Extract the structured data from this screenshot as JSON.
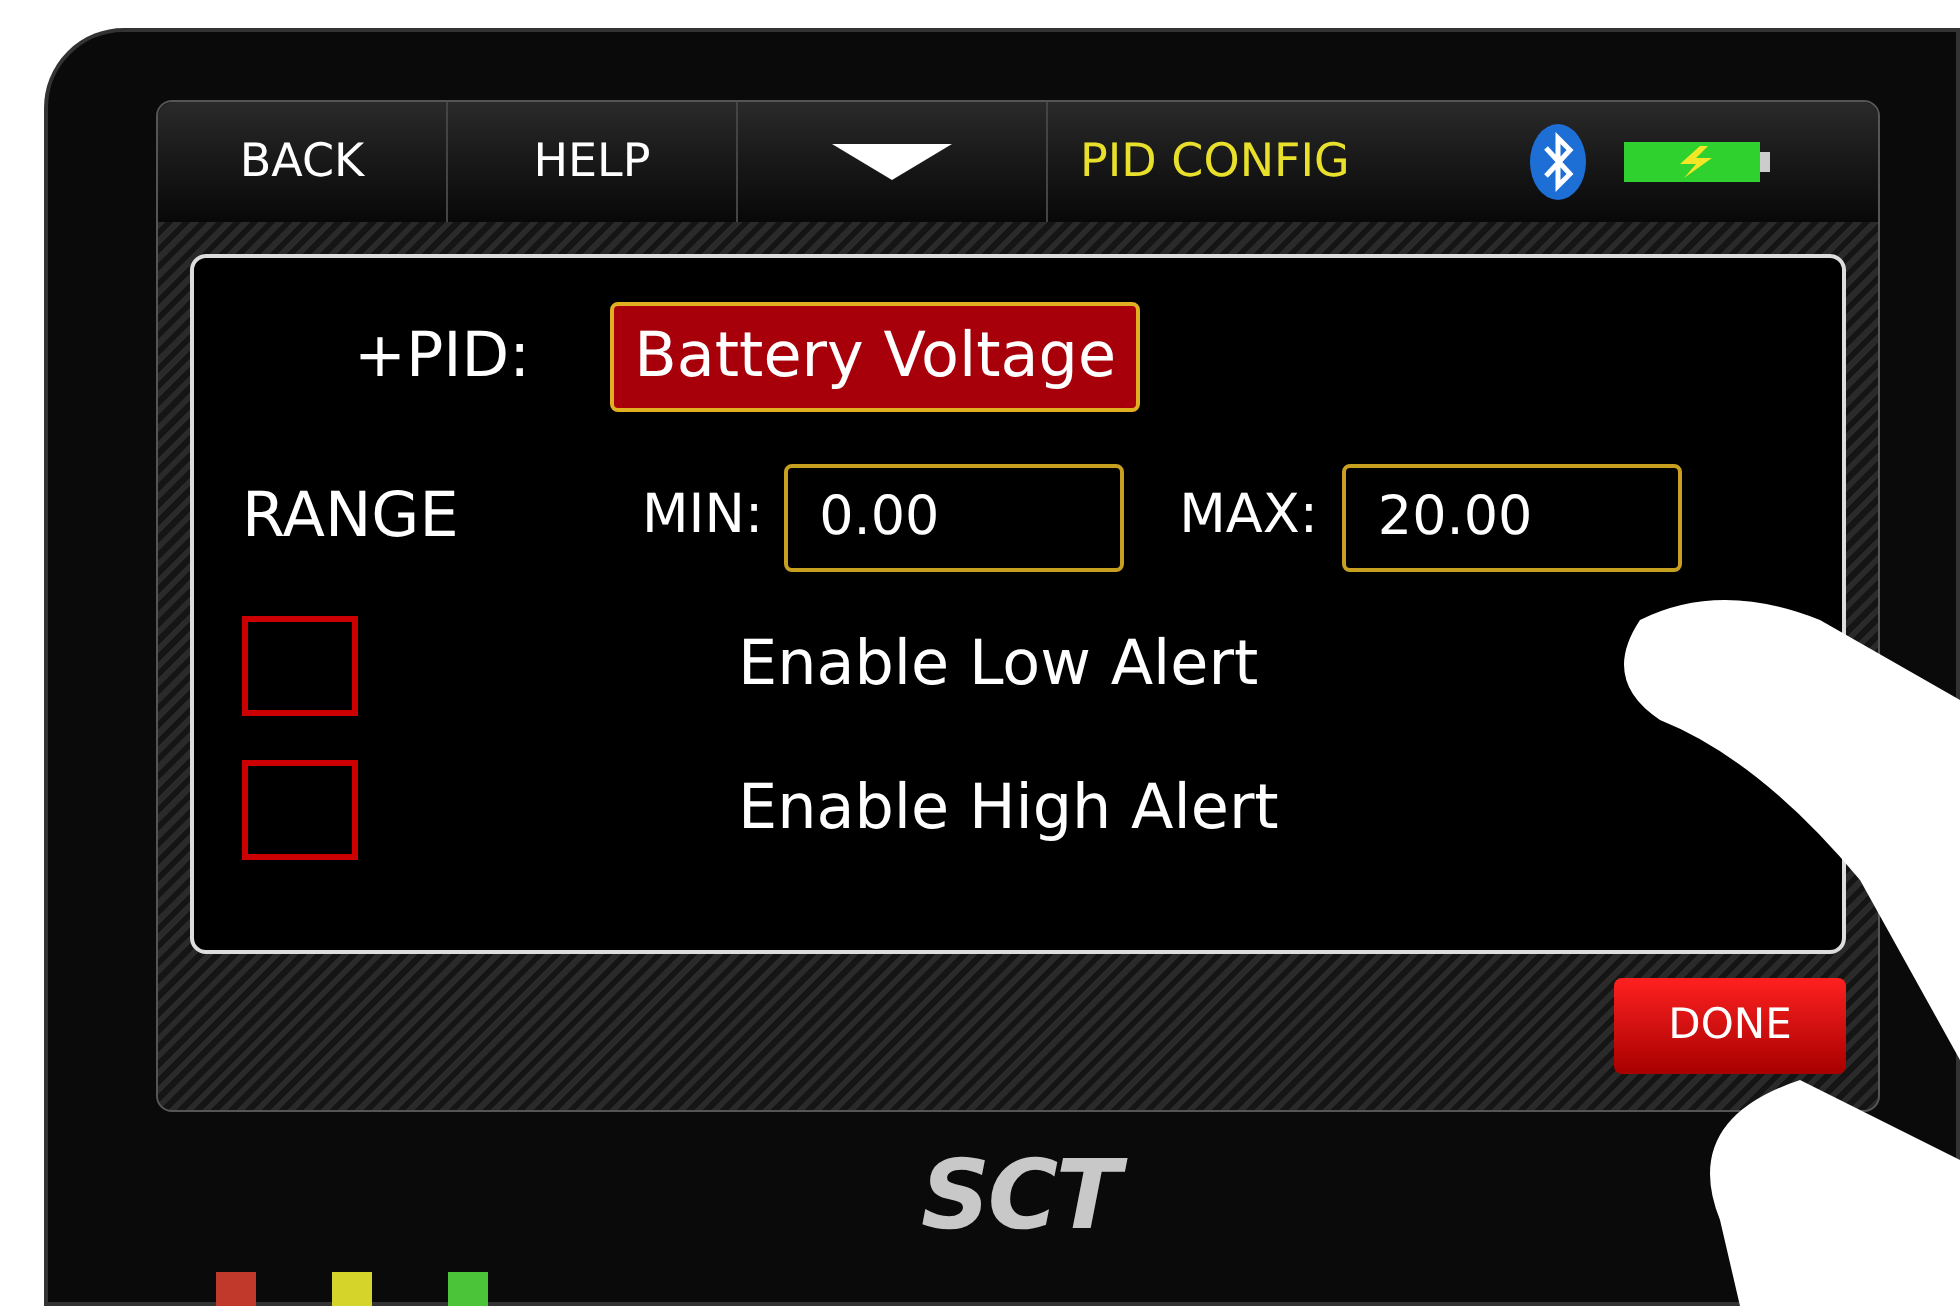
{
  "toolbar": {
    "buttons": [
      {
        "label": "BACK"
      },
      {
        "label": "HELP"
      }
    ],
    "title": "PID CONFIG"
  },
  "pid": {
    "label": "+PID:",
    "value": "Battery Voltage"
  },
  "range": {
    "label": "RANGE",
    "min_label": "MIN:",
    "min": "0.00",
    "max_label": "MAX:",
    "max": "20.00"
  },
  "alerts": [
    {
      "label": "Enable Low Alert",
      "checked": false
    },
    {
      "label": "Enable High Alert",
      "checked": false
    }
  ],
  "done_button": "DONE",
  "logo": "SCT",
  "leds": [
    {
      "color": "#c0392b"
    },
    {
      "color": "#d4d42a"
    },
    {
      "color": "#4cc43a"
    }
  ]
}
